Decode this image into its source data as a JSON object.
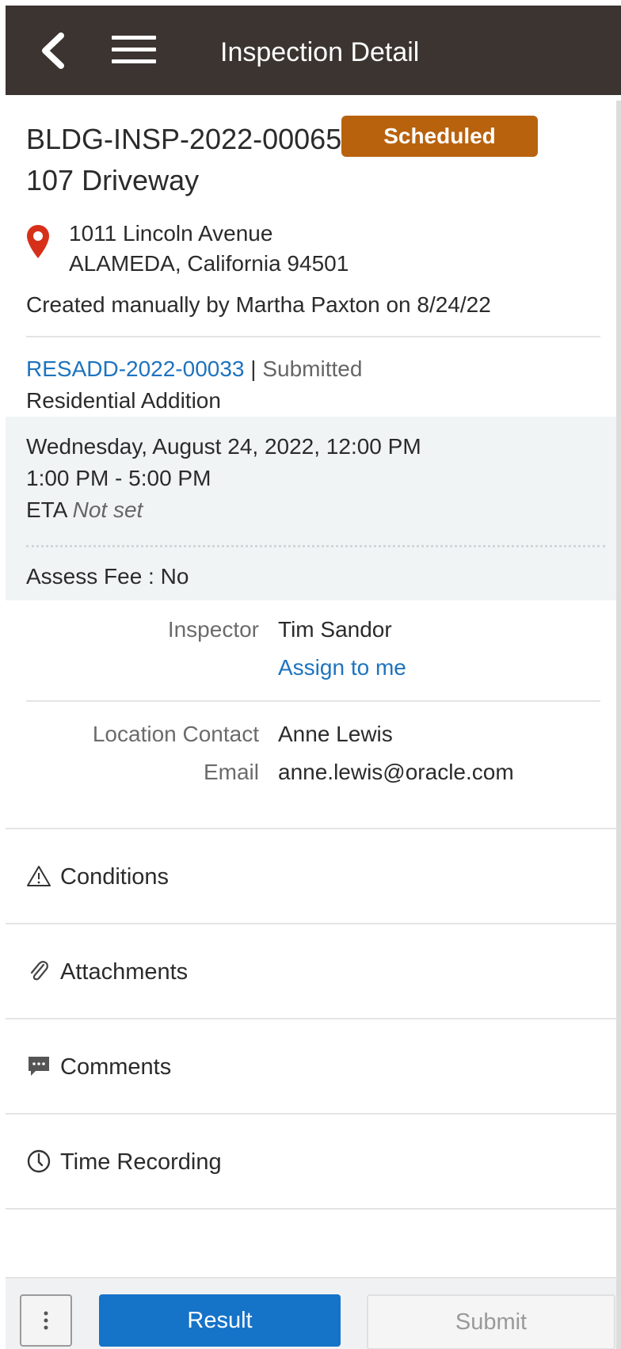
{
  "header": {
    "title": "Inspection Detail"
  },
  "inspection": {
    "id": "BLDG-INSP-2022-00065",
    "status": "Scheduled",
    "name": "107 Driveway",
    "address_line1": "1011 Lincoln Avenue",
    "address_line2": "ALAMEDA, California 94501",
    "created": "Created manually by Martha Paxton on 8/24/22"
  },
  "permit": {
    "id": "RESADD-2022-00033",
    "separator": "|",
    "status": "Submitted",
    "type": "Residential Addition"
  },
  "schedule": {
    "date": "Wednesday, August 24, 2022, 12:00 PM",
    "window": "1:00 PM - 5:00 PM",
    "eta_label": "ETA",
    "eta_value": "Not set",
    "assess_fee": "Assess Fee : No"
  },
  "people": {
    "inspector_label": "Inspector",
    "inspector_value": "Tim Sandor",
    "assign_link": "Assign to me",
    "contact_label": "Location Contact",
    "contact_value": "Anne Lewis",
    "email_label": "Email",
    "email_value": "anne.lewis@oracle.com"
  },
  "sections": [
    {
      "label": "Conditions",
      "icon": "warning-icon"
    },
    {
      "label": "Attachments",
      "icon": "paperclip-icon"
    },
    {
      "label": "Comments",
      "icon": "comment-icon"
    },
    {
      "label": "Time Recording",
      "icon": "clock-icon"
    }
  ],
  "footer": {
    "result_label": "Result",
    "submit_label": "Submit"
  },
  "colors": {
    "header_bg": "#3b3431",
    "badge": "#b8620e",
    "link": "#1e73be",
    "primary_button": "#1573c8",
    "pin": "#d6301a"
  }
}
